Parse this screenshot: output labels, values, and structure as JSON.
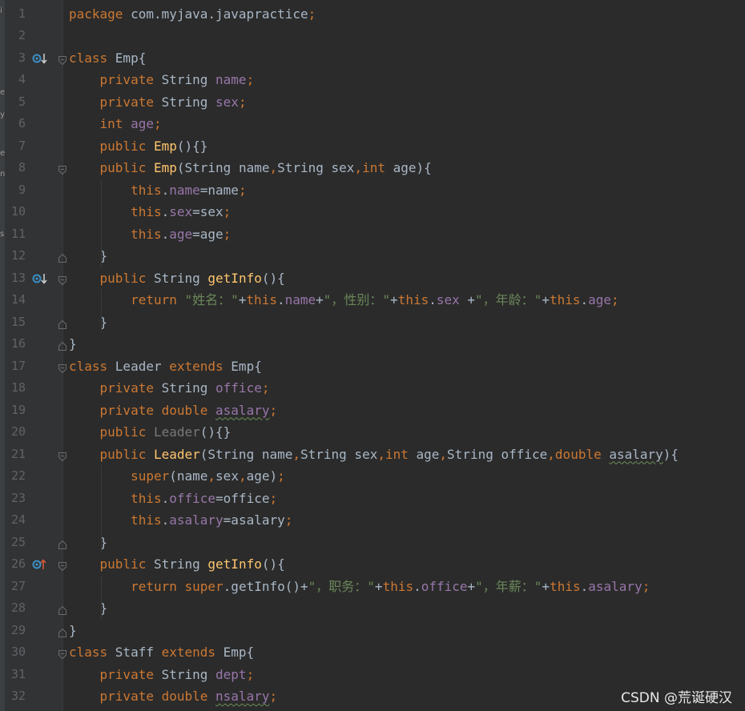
{
  "gutter": {
    "line_numbers": [
      "1",
      "2",
      "3",
      "4",
      "5",
      "6",
      "7",
      "8",
      "9",
      "10",
      "11",
      "12",
      "13",
      "14",
      "15",
      "16",
      "17",
      "18",
      "19",
      "20",
      "21",
      "22",
      "23",
      "24",
      "25",
      "26",
      "27",
      "28",
      "29",
      "30",
      "31",
      "32"
    ]
  },
  "left_strip": {
    "chars": [
      "i",
      "e",
      "y",
      "e",
      "n",
      "s"
    ]
  },
  "code_lines": [
    [
      {
        "t": "package ",
        "c": "kw"
      },
      {
        "t": "com.myjava.javapractice"
      },
      {
        "t": ";",
        "c": "kw"
      }
    ],
    [],
    [
      {
        "t": "class ",
        "c": "kw"
      },
      {
        "t": "Emp{"
      }
    ],
    [
      {
        "t": "    "
      },
      {
        "t": "private ",
        "c": "kw"
      },
      {
        "t": "String "
      },
      {
        "t": "name",
        "c": "field"
      },
      {
        "t": ";",
        "c": "kw"
      }
    ],
    [
      {
        "t": "    "
      },
      {
        "t": "private ",
        "c": "kw"
      },
      {
        "t": "String "
      },
      {
        "t": "sex",
        "c": "field"
      },
      {
        "t": ";",
        "c": "kw"
      }
    ],
    [
      {
        "t": "    "
      },
      {
        "t": "int ",
        "c": "kw"
      },
      {
        "t": "age",
        "c": "field"
      },
      {
        "t": ";",
        "c": "kw"
      }
    ],
    [
      {
        "t": "    "
      },
      {
        "t": "public ",
        "c": "kw"
      },
      {
        "t": "Emp",
        "c": "fn"
      },
      {
        "t": "(){}"
      }
    ],
    [
      {
        "t": "    "
      },
      {
        "t": "public ",
        "c": "kw"
      },
      {
        "t": "Emp",
        "c": "fn"
      },
      {
        "t": "(String name"
      },
      {
        "t": ",",
        "c": "kw"
      },
      {
        "t": "String sex"
      },
      {
        "t": ",",
        "c": "kw"
      },
      {
        "t": "int ",
        "c": "kw"
      },
      {
        "t": "age){"
      }
    ],
    [
      {
        "t": "        "
      },
      {
        "t": "this",
        "c": "kw"
      },
      {
        "t": "."
      },
      {
        "t": "name",
        "c": "field"
      },
      {
        "t": "=name"
      },
      {
        "t": ";",
        "c": "kw"
      }
    ],
    [
      {
        "t": "        "
      },
      {
        "t": "this",
        "c": "kw"
      },
      {
        "t": "."
      },
      {
        "t": "sex",
        "c": "field"
      },
      {
        "t": "=sex"
      },
      {
        "t": ";",
        "c": "kw"
      }
    ],
    [
      {
        "t": "        "
      },
      {
        "t": "this",
        "c": "kw"
      },
      {
        "t": "."
      },
      {
        "t": "age",
        "c": "field"
      },
      {
        "t": "=age"
      },
      {
        "t": ";",
        "c": "kw"
      }
    ],
    [
      {
        "t": "    }"
      }
    ],
    [
      {
        "t": "    "
      },
      {
        "t": "public ",
        "c": "kw"
      },
      {
        "t": "String "
      },
      {
        "t": "getInfo",
        "c": "fn"
      },
      {
        "t": "(){"
      }
    ],
    [
      {
        "t": "        "
      },
      {
        "t": "return ",
        "c": "kw"
      },
      {
        "t": "\"姓名：\"",
        "c": "str"
      },
      {
        "t": "+"
      },
      {
        "t": "this",
        "c": "kw"
      },
      {
        "t": "."
      },
      {
        "t": "name",
        "c": "field"
      },
      {
        "t": "+"
      },
      {
        "t": "\"，性别：\"",
        "c": "str"
      },
      {
        "t": "+"
      },
      {
        "t": "this",
        "c": "kw"
      },
      {
        "t": "."
      },
      {
        "t": "sex",
        "c": "field"
      },
      {
        "t": " +"
      },
      {
        "t": "\"，年龄：\"",
        "c": "str"
      },
      {
        "t": "+"
      },
      {
        "t": "this",
        "c": "kw"
      },
      {
        "t": "."
      },
      {
        "t": "age",
        "c": "field"
      },
      {
        "t": ";",
        "c": "kw"
      }
    ],
    [
      {
        "t": "    }"
      }
    ],
    [
      {
        "t": "}"
      }
    ],
    [
      {
        "t": "class ",
        "c": "kw"
      },
      {
        "t": "Leader "
      },
      {
        "t": "extends ",
        "c": "kw"
      },
      {
        "t": "Emp{"
      }
    ],
    [
      {
        "t": "    "
      },
      {
        "t": "private ",
        "c": "kw"
      },
      {
        "t": "String "
      },
      {
        "t": "office",
        "c": "field"
      },
      {
        "t": ";",
        "c": "kw"
      }
    ],
    [
      {
        "t": "    "
      },
      {
        "t": "private ",
        "c": "kw"
      },
      {
        "t": "double ",
        "c": "kw"
      },
      {
        "t": "asalary",
        "c": "field warn"
      },
      {
        "t": ";",
        "c": "kw"
      }
    ],
    [
      {
        "t": "    "
      },
      {
        "t": "public ",
        "c": "kw"
      },
      {
        "t": "Leader",
        "c": "unused"
      },
      {
        "t": "(){}"
      }
    ],
    [
      {
        "t": "    "
      },
      {
        "t": "public ",
        "c": "kw"
      },
      {
        "t": "Leader",
        "c": "fn"
      },
      {
        "t": "(String name"
      },
      {
        "t": ",",
        "c": "kw"
      },
      {
        "t": "String sex"
      },
      {
        "t": ",",
        "c": "kw"
      },
      {
        "t": "int ",
        "c": "kw"
      },
      {
        "t": "age"
      },
      {
        "t": ",",
        "c": "kw"
      },
      {
        "t": "String office"
      },
      {
        "t": ",",
        "c": "kw"
      },
      {
        "t": "double ",
        "c": "kw"
      },
      {
        "t": "asalary",
        "c": "warn"
      },
      {
        "t": "){"
      }
    ],
    [
      {
        "t": "        "
      },
      {
        "t": "super",
        "c": "kw"
      },
      {
        "t": "(name"
      },
      {
        "t": ",",
        "c": "kw"
      },
      {
        "t": "sex"
      },
      {
        "t": ",",
        "c": "kw"
      },
      {
        "t": "age)"
      },
      {
        "t": ";",
        "c": "kw"
      }
    ],
    [
      {
        "t": "        "
      },
      {
        "t": "this",
        "c": "kw"
      },
      {
        "t": "."
      },
      {
        "t": "office",
        "c": "field"
      },
      {
        "t": "=office"
      },
      {
        "t": ";",
        "c": "kw"
      }
    ],
    [
      {
        "t": "        "
      },
      {
        "t": "this",
        "c": "kw"
      },
      {
        "t": "."
      },
      {
        "t": "asalary",
        "c": "field"
      },
      {
        "t": "=asalary"
      },
      {
        "t": ";",
        "c": "kw"
      }
    ],
    [
      {
        "t": "    }"
      }
    ],
    [
      {
        "t": "    "
      },
      {
        "t": "public ",
        "c": "kw"
      },
      {
        "t": "String "
      },
      {
        "t": "getInfo",
        "c": "fn"
      },
      {
        "t": "(){"
      }
    ],
    [
      {
        "t": "        "
      },
      {
        "t": "return ",
        "c": "kw"
      },
      {
        "t": "super",
        "c": "kw"
      },
      {
        "t": ".getInfo()+"
      },
      {
        "t": "\"，职务：\"",
        "c": "str"
      },
      {
        "t": "+"
      },
      {
        "t": "this",
        "c": "kw"
      },
      {
        "t": "."
      },
      {
        "t": "office",
        "c": "field"
      },
      {
        "t": "+"
      },
      {
        "t": "\"，年薪：\"",
        "c": "str"
      },
      {
        "t": "+"
      },
      {
        "t": "this",
        "c": "kw"
      },
      {
        "t": "."
      },
      {
        "t": "asalary",
        "c": "field"
      },
      {
        "t": ";",
        "c": "kw"
      }
    ],
    [
      {
        "t": "    }"
      }
    ],
    [
      {
        "t": "}"
      }
    ],
    [
      {
        "t": "class ",
        "c": "kw"
      },
      {
        "t": "Staff "
      },
      {
        "t": "extends ",
        "c": "kw"
      },
      {
        "t": "Emp{"
      }
    ],
    [
      {
        "t": "    "
      },
      {
        "t": "private ",
        "c": "kw"
      },
      {
        "t": "String "
      },
      {
        "t": "dept",
        "c": "field"
      },
      {
        "t": ";",
        "c": "kw"
      }
    ],
    [
      {
        "t": "    "
      },
      {
        "t": "private ",
        "c": "kw"
      },
      {
        "t": "double ",
        "c": "kw"
      },
      {
        "t": "nsalary",
        "c": "field warn"
      },
      {
        "t": ";",
        "c": "kw"
      }
    ]
  ],
  "gutter_icons": [
    {
      "line": 3,
      "icon": "implemented-down-icon"
    },
    {
      "line": 13,
      "icon": "implemented-down-icon"
    },
    {
      "line": 26,
      "icon": "override-up-icon"
    }
  ],
  "fold_markers": [
    {
      "line": 3,
      "kind": "open"
    },
    {
      "line": 8,
      "kind": "open"
    },
    {
      "line": 12,
      "kind": "close"
    },
    {
      "line": 13,
      "kind": "open"
    },
    {
      "line": 15,
      "kind": "close"
    },
    {
      "line": 16,
      "kind": "close"
    },
    {
      "line": 17,
      "kind": "open"
    },
    {
      "line": 21,
      "kind": "open"
    },
    {
      "line": 25,
      "kind": "close"
    },
    {
      "line": 26,
      "kind": "open"
    },
    {
      "line": 28,
      "kind": "close"
    },
    {
      "line": 29,
      "kind": "close"
    },
    {
      "line": 30,
      "kind": "open"
    }
  ],
  "colors": {
    "background": "#2b2b2b",
    "keyword": "#cc7832",
    "field": "#9876aa",
    "method": "#ffc66d",
    "string": "#6a8759",
    "plain": "#a9b7c6",
    "line_number": "#606366"
  },
  "watermark": "CSDN @荒诞硬汉"
}
